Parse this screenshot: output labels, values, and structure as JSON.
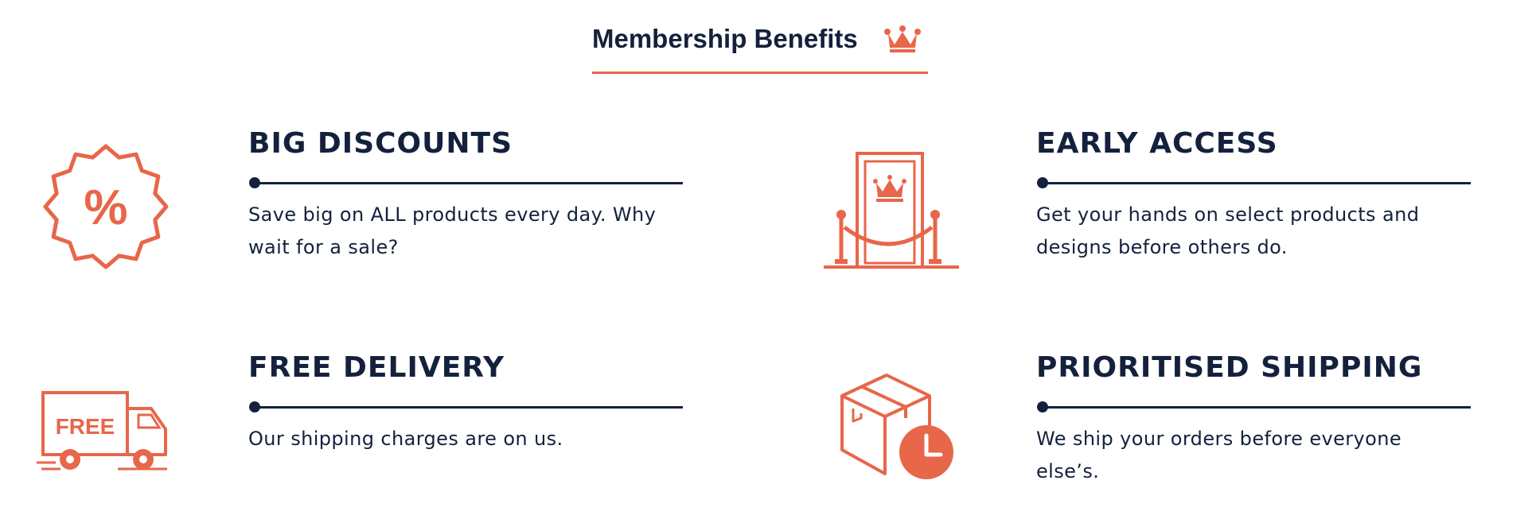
{
  "header": {
    "title": "Membership Benefits",
    "icon": "crown-icon"
  },
  "colors": {
    "accent": "#e8664a",
    "text": "#14213d",
    "background": "#ffffff"
  },
  "benefits": [
    {
      "title": "BIG DISCOUNTS",
      "description": "Save big on ALL products every day. Why wait for a sale?",
      "icon": "discount-badge-icon",
      "icon_text": "%"
    },
    {
      "title": "EARLY ACCESS",
      "description": "Get your hands on select products and designs before others do.",
      "icon": "vip-door-icon"
    },
    {
      "title": "FREE DELIVERY",
      "description": "Our shipping charges are on us.",
      "icon": "delivery-truck-icon",
      "icon_text": "FREE"
    },
    {
      "title": "PRIORITISED SHIPPING",
      "description": "We ship your orders before everyone else’s.",
      "icon": "box-clock-icon"
    }
  ]
}
